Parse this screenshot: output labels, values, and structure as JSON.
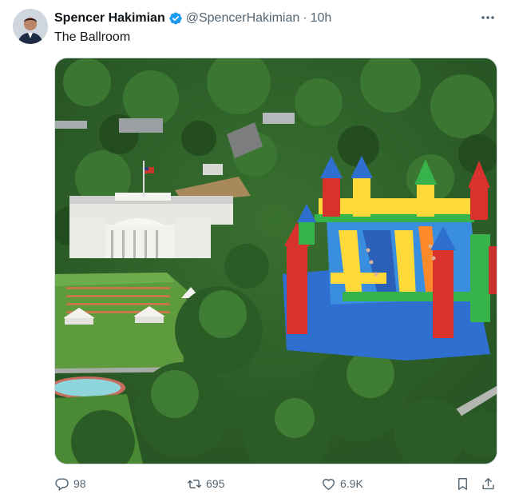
{
  "author": {
    "display_name": "Spencer Hakimian",
    "handle": "@SpencerHakimian",
    "separator": "·",
    "time": "10h"
  },
  "tweet": {
    "text": "The Ballroom"
  },
  "stats": {
    "replies": "98",
    "reposts": "695",
    "likes": "6.9K"
  },
  "icons": {
    "verified": "verified-badge-icon",
    "more": "more-options-icon",
    "reply": "reply-icon",
    "repost": "repost-icon",
    "like": "like-icon",
    "bookmark": "bookmark-icon",
    "share": "share-icon"
  },
  "colors": {
    "verified_blue": "#1d9bf0",
    "muted_text": "#536471",
    "primary_text": "#0f1419"
  }
}
